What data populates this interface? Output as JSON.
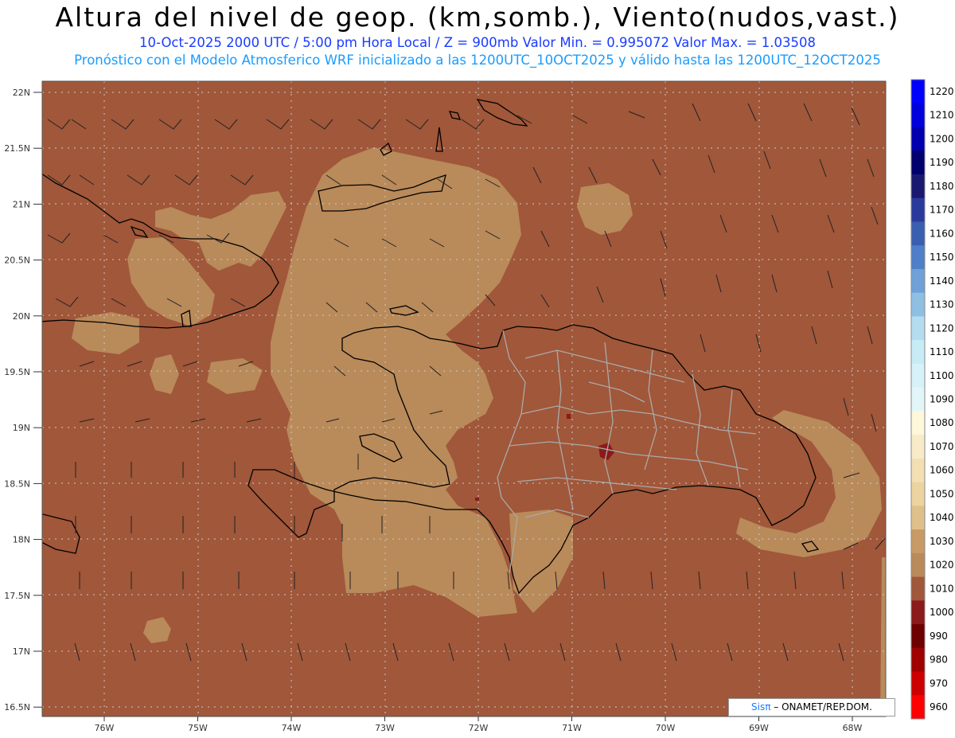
{
  "header": {
    "title": "Altura del nivel de geop. (km,somb.), Viento(nudos,vast.)",
    "subtitle": "10-Oct-2025   2000 UTC / 5:00 pm Hora Local / Z = 900mb    Valor Min. = 0.995072  Valor Max. = 1.03508",
    "model_line": "Pronóstico con el Modelo Atmosferico WRF inicializado a las 1200UTC_10OCT2025 y válido hasta las  1200UTC_12OCT2025"
  },
  "map": {
    "lat_labels": [
      "22N",
      "21.5N",
      "21N",
      "20.5N",
      "20N",
      "19.5N",
      "19N",
      "18.5N",
      "18N",
      "17.5N",
      "17N",
      "16.5N"
    ],
    "lon_labels": [
      "76W",
      "75W",
      "74W",
      "73W",
      "72W",
      "71W",
      "70W",
      "69W",
      "68W"
    ],
    "colors": {
      "low": "#a0573a",
      "mid": "#b98a5a",
      "darkred": "#8b1a1a",
      "border": "#000000",
      "provinces": "#aaaaaa",
      "grid": "#cccccc"
    }
  },
  "colorbar": {
    "levels": [
      "1220",
      "1210",
      "1200",
      "1190",
      "1180",
      "1170",
      "1160",
      "1150",
      "1140",
      "1130",
      "1120",
      "1110",
      "1100",
      "1090",
      "1080",
      "1070",
      "1060",
      "1050",
      "1040",
      "1030",
      "1020",
      "1010",
      "1000",
      "990",
      "980",
      "970",
      "960"
    ],
    "colors": [
      "#0000ff",
      "#0000dd",
      "#0000b0",
      "#00006e",
      "#191970",
      "#2a3a9c",
      "#3b5fb0",
      "#4f7fc8",
      "#6fa0d8",
      "#8fc0e4",
      "#b4dcef",
      "#c8ecf5",
      "#d6f2f8",
      "#e2f6fa",
      "#fff7da",
      "#f8ecc8",
      "#f2e0b4",
      "#ecd4a0",
      "#e0c08a",
      "#c89a66",
      "#b98a5a",
      "#a0573a",
      "#8b1a1a",
      "#6e0000",
      "#a00000",
      "#cc0000",
      "#ff0000"
    ]
  },
  "credit": {
    "logo": "Sisπ",
    "text": "– ONAMET/REP.DOM."
  }
}
